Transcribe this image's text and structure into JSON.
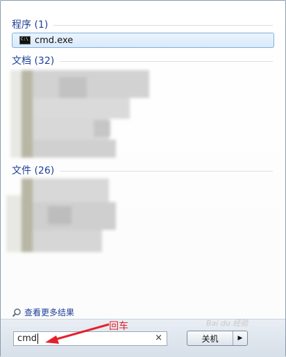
{
  "sections": {
    "programs": {
      "label": "程序 (1)"
    },
    "documents": {
      "label": "文档 (32)"
    },
    "files": {
      "label": "文件 (26)"
    }
  },
  "program_items": [
    {
      "label": "cmd.exe",
      "icon": "cmd-icon"
    }
  ],
  "see_more": {
    "label": "查看更多结果",
    "icon": "search-icon"
  },
  "search": {
    "value": "cmd",
    "clear_icon": "×"
  },
  "shutdown": {
    "label": "关机",
    "arrow": "▶"
  },
  "annotation": {
    "text": "回车",
    "color": "#e6202a"
  },
  "watermark": {
    "text": "Bai du 经验"
  }
}
